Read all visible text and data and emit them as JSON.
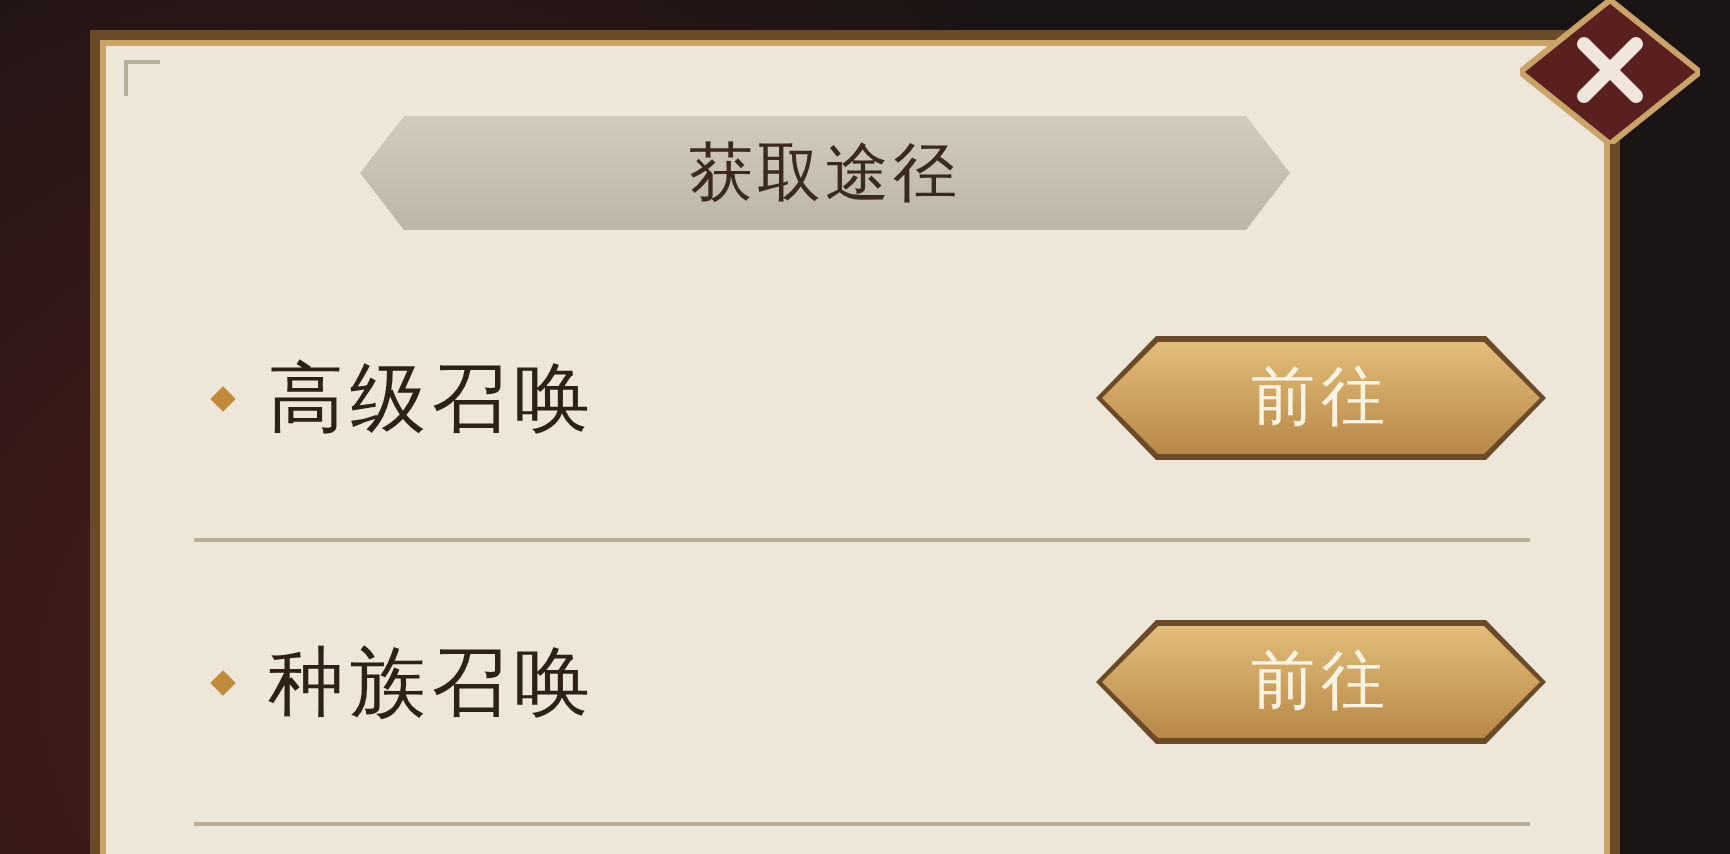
{
  "dialog": {
    "title": "获取途径",
    "rows": [
      {
        "label": "高级召唤",
        "button": "前往"
      },
      {
        "label": "种族召唤",
        "button": "前往"
      }
    ]
  }
}
